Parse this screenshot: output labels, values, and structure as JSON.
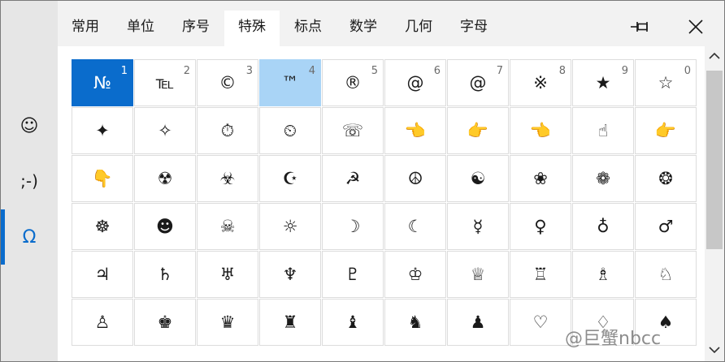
{
  "tabs": [
    "常用",
    "单位",
    "序号",
    "特殊",
    "标点",
    "数学",
    "几何",
    "字母"
  ],
  "active_tab": "特殊",
  "sidebar": {
    "items": [
      {
        "name": "emoji",
        "symbol": "☺"
      },
      {
        "name": "kaomoji",
        "symbol": ";-)"
      },
      {
        "name": "symbols",
        "symbol": "Ω"
      }
    ],
    "active": "symbols"
  },
  "header_icons": {
    "pin": "pin-icon",
    "close": "close-icon"
  },
  "grid": {
    "rows": [
      [
        {
          "glyph": "№",
          "num": "1"
        },
        {
          "glyph": "℡",
          "num": "2"
        },
        {
          "glyph": "©",
          "num": "3"
        },
        {
          "glyph": "™",
          "num": "4"
        },
        {
          "glyph": "®",
          "num": "5"
        },
        {
          "glyph": "@",
          "num": "6"
        },
        {
          "glyph": "@",
          "num": "7"
        },
        {
          "glyph": "※",
          "num": "8"
        },
        {
          "glyph": "★",
          "num": "9"
        },
        {
          "glyph": "☆",
          "num": "0"
        }
      ],
      [
        "✦",
        "✧",
        "⏱",
        "⏲",
        "☏",
        "👈",
        "👉",
        "👈",
        "☝",
        "👉"
      ],
      [
        "👇",
        "☢",
        "☣",
        "☪",
        "☭",
        "☮",
        "☯",
        "❀",
        "❁",
        "❂"
      ],
      [
        "☸",
        "☻",
        "☠",
        "☼",
        "☽",
        "☾",
        "☿",
        "♀",
        "♁",
        "♂"
      ],
      [
        "♃",
        "♄",
        "♅",
        "♆",
        "♇",
        "♔",
        "♕",
        "♖",
        "♗",
        "♘"
      ],
      [
        "♙",
        "♚",
        "♛",
        "♜",
        "♝",
        "♞",
        "♟",
        "♡",
        "♢",
        "♠"
      ]
    ],
    "selected": [
      0,
      0
    ],
    "hover": [
      0,
      3
    ]
  },
  "watermark": "@巨蟹nbcc",
  "colors": {
    "accent": "#0a6ccc",
    "hover": "#a9d4f6",
    "emoji_yellow": "#f6c443",
    "purple_box": "#6e5bc8"
  }
}
